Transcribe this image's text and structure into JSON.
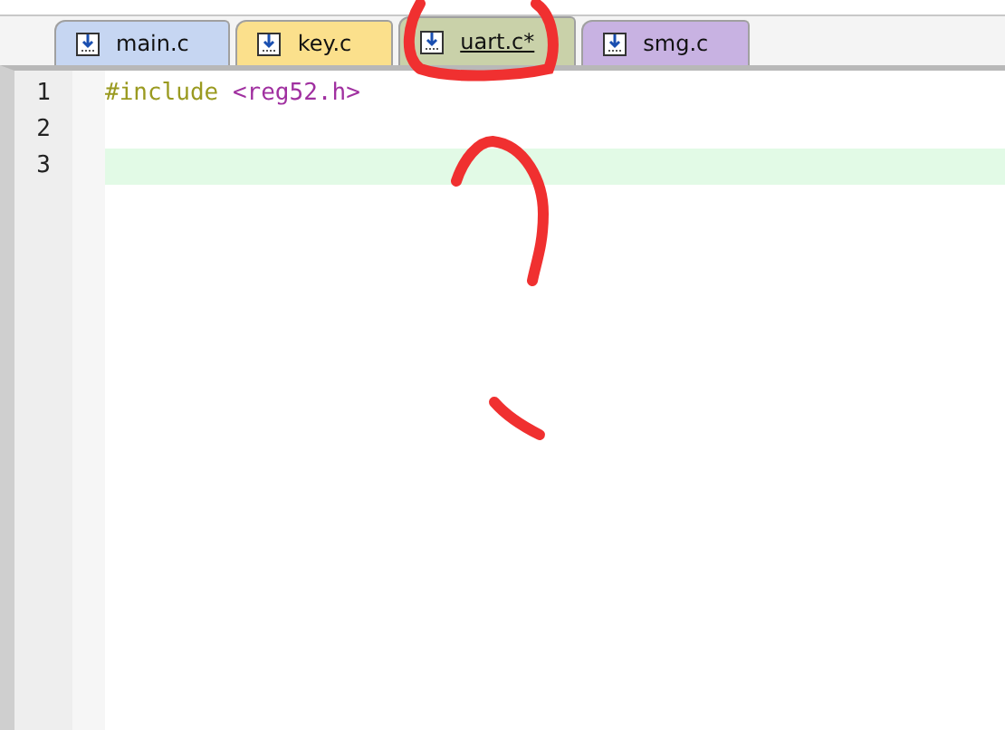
{
  "tabs": [
    {
      "label": "main.c",
      "selected": false,
      "color": "#c6d6f2"
    },
    {
      "label": "key.c",
      "selected": false,
      "color": "#fbe08c"
    },
    {
      "label": "uart.c*",
      "selected": true,
      "color": "#c9d1a9"
    },
    {
      "label": "smg.c",
      "selected": false,
      "color": "#c8b2e2"
    }
  ],
  "editor": {
    "lines": [
      {
        "number": "1",
        "current": false,
        "tokens": [
          {
            "kind": "directive",
            "text": "#include"
          },
          {
            "kind": "header",
            "text": "<reg52.h>"
          }
        ]
      },
      {
        "number": "2",
        "current": false
      },
      {
        "number": "3",
        "current": true
      }
    ]
  }
}
